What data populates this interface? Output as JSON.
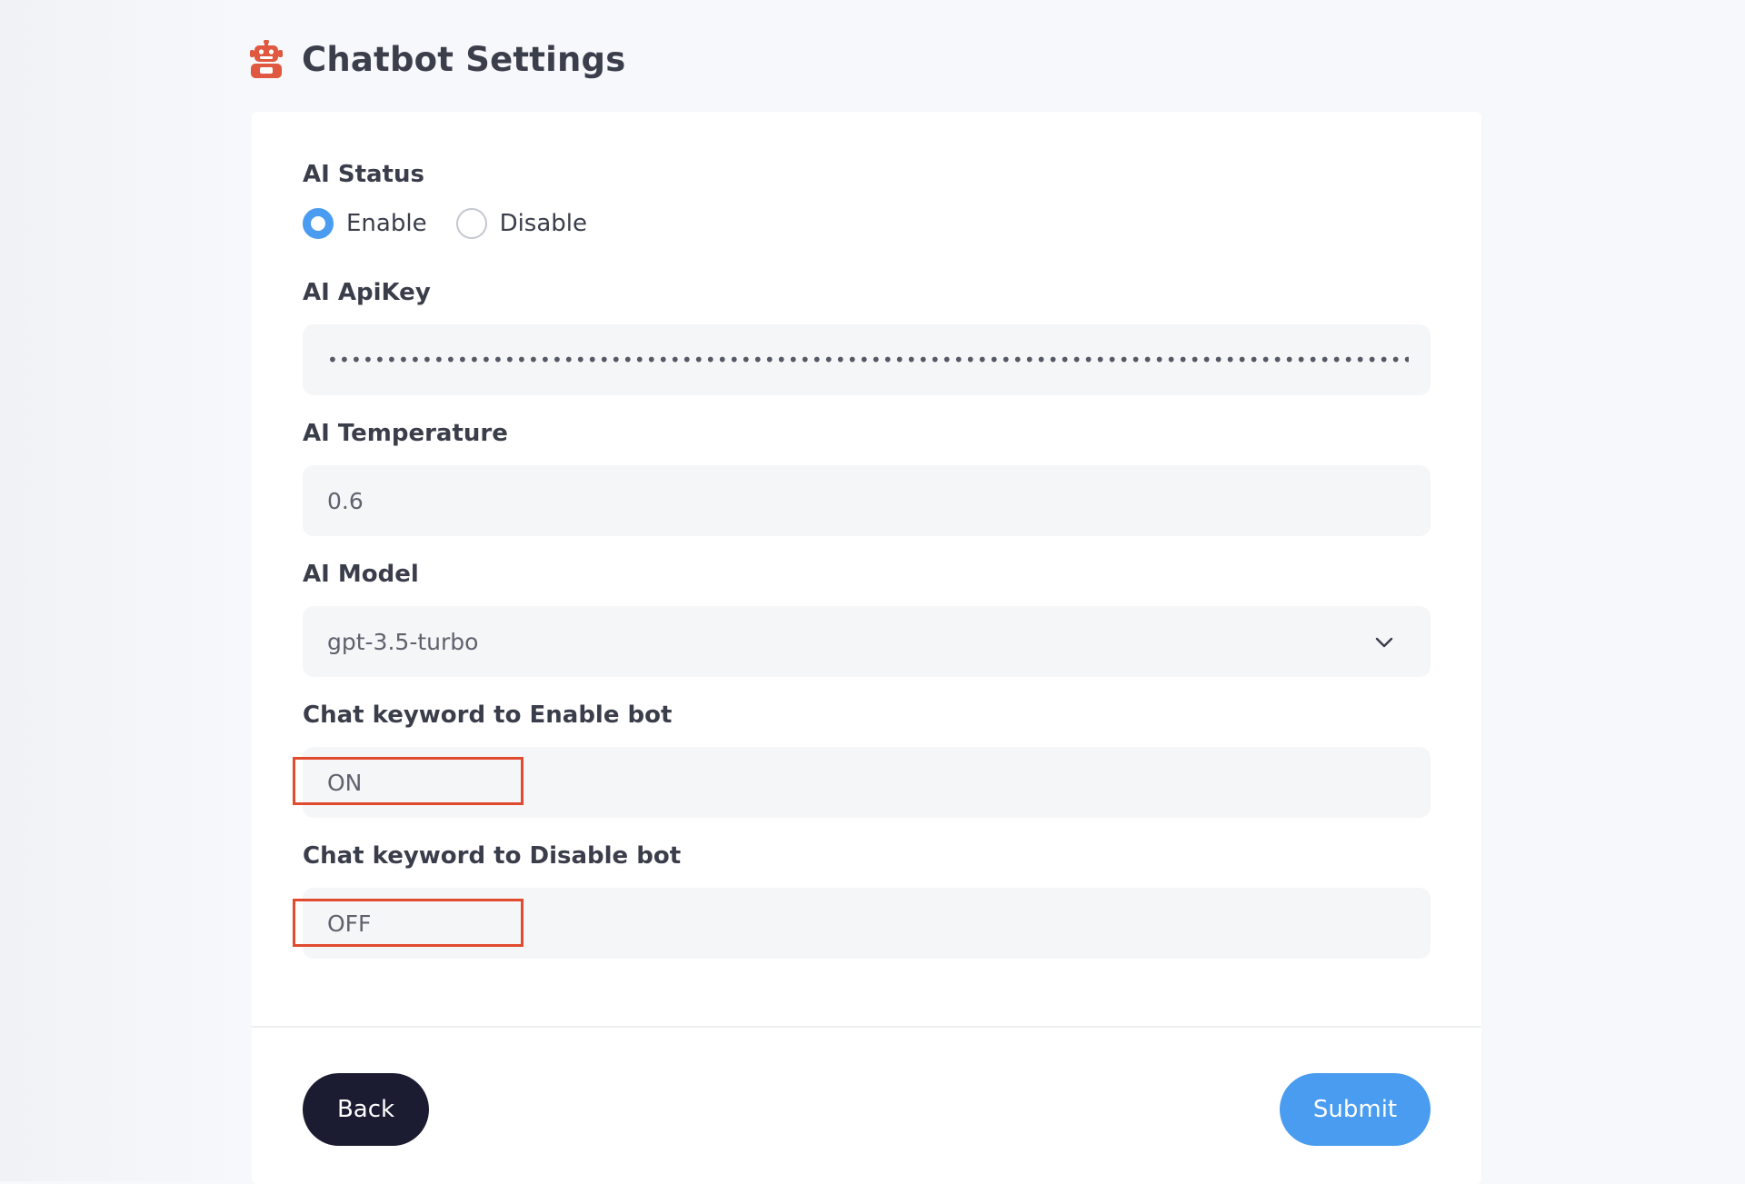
{
  "page": {
    "title": "Chatbot Settings",
    "icon": "robot-icon"
  },
  "ai_status": {
    "label": "AI Status",
    "options": [
      {
        "label": "Enable",
        "checked": true
      },
      {
        "label": "Disable",
        "checked": false
      }
    ]
  },
  "api_key": {
    "label": "AI ApiKey",
    "value": "••••••••••••••••••••••••••••••••••••••••••••••••••••••••••••••••••••••••••••••••••••••••••••••••••••••"
  },
  "temperature": {
    "label": "AI Temperature",
    "value": "0.6"
  },
  "model": {
    "label": "AI Model",
    "selected": "gpt-3.5-turbo",
    "icon": "chevron-down-icon"
  },
  "enable_keyword": {
    "label": "Chat keyword to Enable bot",
    "value": "ON"
  },
  "disable_keyword": {
    "label": "Chat keyword to Disable bot",
    "value": "OFF"
  },
  "actions": {
    "back_label": "Back",
    "submit_label": "Submit"
  },
  "colors": {
    "accent": "#4a9cf0",
    "dark_button": "#1b1c31",
    "highlight": "#e04a2f",
    "robot": "#e0583f"
  }
}
